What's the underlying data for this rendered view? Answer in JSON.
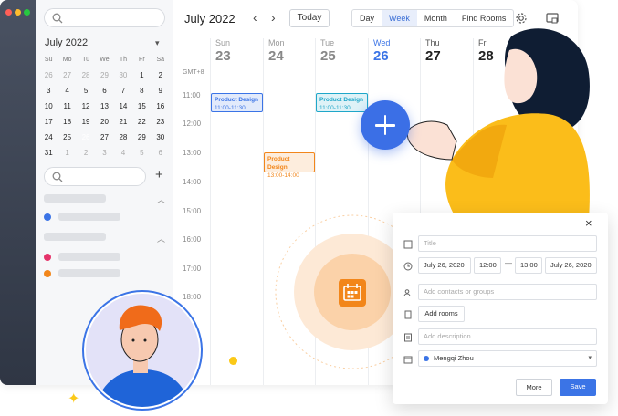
{
  "window": {
    "dots": [
      "#ff5f57",
      "#febc2e",
      "#28c840"
    ]
  },
  "sidebar": {
    "mini_calendar": {
      "title": "July 2022",
      "dows": [
        "Su",
        "Mo",
        "Tu",
        "We",
        "Th",
        "Fr",
        "Sa"
      ],
      "rows": [
        [
          "26",
          "27",
          "28",
          "29",
          "30",
          "1",
          "2"
        ],
        [
          "3",
          "4",
          "5",
          "6",
          "7",
          "8",
          "9"
        ],
        [
          "10",
          "11",
          "12",
          "13",
          "14",
          "15",
          "16"
        ],
        [
          "17",
          "18",
          "19",
          "20",
          "21",
          "22",
          "23"
        ],
        [
          "24",
          "25",
          "26",
          "27",
          "28",
          "29",
          "30"
        ],
        [
          "31",
          "1",
          "2",
          "3",
          "4",
          "5",
          "6"
        ]
      ],
      "selected_day": "26"
    },
    "calendar_colors": [
      "#3b74e6",
      "#e5336a",
      "#f2861a"
    ]
  },
  "header": {
    "month_title": "July 2022",
    "prev": "‹",
    "next": "›",
    "today_label": "Today",
    "views": [
      "Day",
      "Week",
      "Month",
      "Find Rooms"
    ],
    "active_view": "Week"
  },
  "week": {
    "timezone": "GMT+8",
    "days": [
      {
        "name": "Sun",
        "date": "23"
      },
      {
        "name": "Mon",
        "date": "24"
      },
      {
        "name": "Tue",
        "date": "25"
      },
      {
        "name": "Wed",
        "date": "26"
      },
      {
        "name": "Thu",
        "date": "27"
      },
      {
        "name": "Fri",
        "date": "28"
      }
    ],
    "times": [
      "11:00",
      "12:00",
      "13:00",
      "14:00",
      "15:00",
      "16:00",
      "17:00",
      "18:00"
    ],
    "events": [
      {
        "title": "Product Design",
        "time": "11:00-11:30",
        "color": "#3b74e6"
      },
      {
        "title": "Product Design",
        "time": "11:00-11:30",
        "color": "#1fa7c9"
      },
      {
        "title": "Product Design",
        "time": "13:00-14:00",
        "color": "#f2861a"
      }
    ]
  },
  "dialog": {
    "close": "×",
    "title_placeholder": "Title",
    "start_date": "July 26, 2020",
    "start_time": "12:00",
    "dash": "—",
    "end_time": "13:00",
    "end_date": "July 26, 2020",
    "contacts_placeholder": "Add contacts or groups",
    "add_rooms": "Add rooms",
    "description_placeholder": "Add description",
    "owner": "Mengqi Zhou",
    "more": "More",
    "save": "Save",
    "accent": "#3b74e6"
  }
}
